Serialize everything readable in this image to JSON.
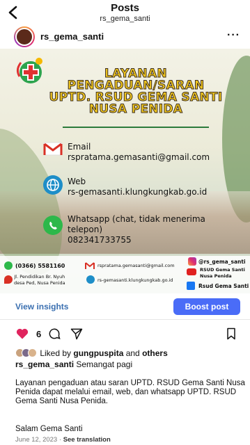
{
  "header": {
    "title": "Posts",
    "subtitle": "rs_gema_santi"
  },
  "post": {
    "username": "rs_gema_santi",
    "more_icon": "more-horizontal-icon",
    "image": {
      "title_lines": [
        "LAYANAN",
        "PENGADUAN/SARAN",
        "UPTD. RSUD GEMA SANTI",
        "NUSA PENIDA"
      ],
      "email_label": "Email",
      "email": "rspratama.gemasanti@gmail.com",
      "web_label": "Web",
      "web": "rs-gemasanti.klungkungkab.go.id",
      "wa_label": "Whatsapp (chat, tidak menerima",
      "wa_label2": "telepon)",
      "wa_number": "082341733755",
      "footer": {
        "phone": "(0366) 5581160",
        "email": "rspratama.gemasanti@gmail.com",
        "ig": "@rs_gema_santi",
        "address_line1": "Jl. Pendidikan Br. Nyuh",
        "address_line2": "desa Ped, Nusa Penida",
        "web": "rs-gemasanti.klungkungkab.go.id",
        "yt_line1": "RSUD Gema Santi",
        "yt_line2": "Nusa Penida",
        "fb": "Rsud Gema Santi"
      }
    },
    "insights_label": "View insights",
    "boost_label": "Boost post",
    "like_count": "6",
    "liked_prefix": "Liked by ",
    "liked_user": "gungpuspita",
    "liked_and": " and ",
    "liked_others": "others",
    "caption_user": "rs_gema_santi",
    "caption_text": " Semangat pagi",
    "body": "Layanan pengaduan atau saran UPTD. RSUD Gema Santi Nusa Penida dapat melalui email, web, dan whatsapp UPTD. RSUD Gema Santi Nusa Penida.",
    "salam": "Salam Gema Santi",
    "date": "June 12, 2023",
    "dot": " · ",
    "translate": "See translation"
  },
  "colors": {
    "accent": "#4a6cf7",
    "link": "#3a6fb0",
    "heart": "#e0245e",
    "title_yellow": "#f0c61e"
  }
}
